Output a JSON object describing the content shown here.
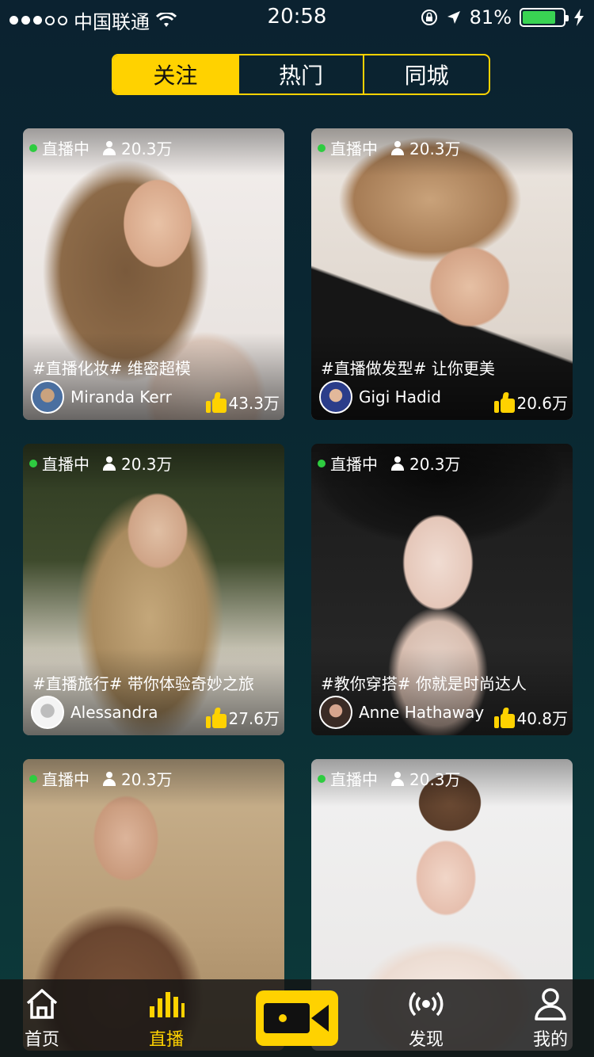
{
  "status_bar": {
    "carrier": "中国联通",
    "time": "20:58",
    "battery_percent": "81%",
    "battery_level": 0.81,
    "battery_color": "#39d353"
  },
  "tabs": {
    "items": [
      {
        "label": "关注",
        "active": true
      },
      {
        "label": "热门",
        "active": false
      },
      {
        "label": "同城",
        "active": false
      }
    ],
    "accent": "#ffd200"
  },
  "live_label": "直播中",
  "cards": [
    {
      "viewers": "20.3万",
      "caption": "#直播化妆# 维密超模",
      "author": "Miranda Kerr",
      "likes": "43.3万"
    },
    {
      "viewers": "20.3万",
      "caption": "#直播做发型# 让你更美",
      "author": "Gigi Hadid",
      "likes": "20.6万"
    },
    {
      "viewers": "20.3万",
      "caption": "#直播旅行# 带你体验奇妙之旅",
      "author": "Alessandra",
      "likes": "27.6万"
    },
    {
      "viewers": "20.3万",
      "caption": "#教你穿搭# 你就是时尚达人",
      "author": "Anne Hathaway",
      "likes": "40.8万"
    },
    {
      "viewers": "20.3万",
      "caption": "",
      "author": "",
      "likes": ""
    },
    {
      "viewers": "20.3万",
      "caption": "",
      "author": "",
      "likes": ""
    }
  ],
  "tab_bar": {
    "home": "首页",
    "live": "直播",
    "discover": "发现",
    "me": "我的"
  }
}
